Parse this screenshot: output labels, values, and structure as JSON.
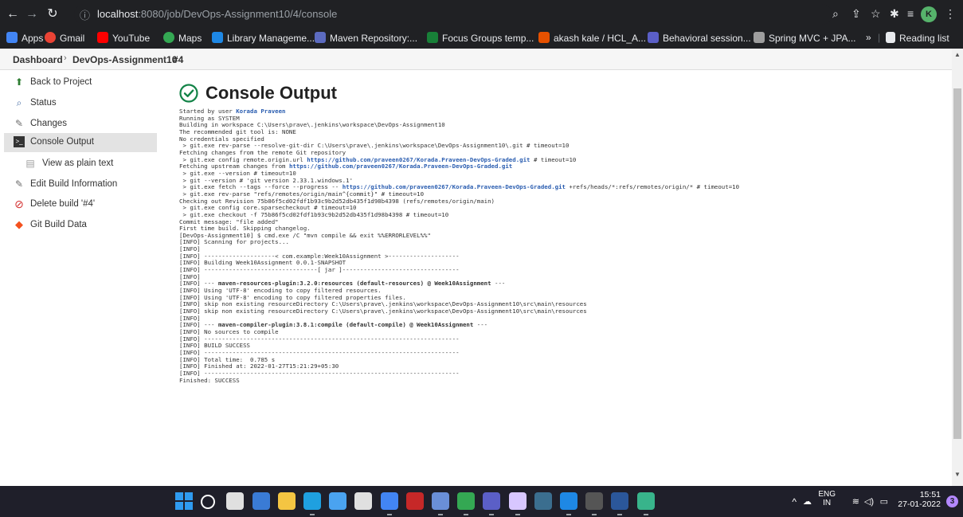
{
  "browser": {
    "url_host": "localhost",
    "url_rest": ":8080/job/DevOps-Assignment10/4/console",
    "profile_initial": "K"
  },
  "bookmarks": [
    {
      "label": "Apps",
      "color": "#4285f4"
    },
    {
      "label": "Gmail",
      "color": "#ea4335"
    },
    {
      "label": "YouTube",
      "color": "#ff0000"
    },
    {
      "label": "Maps",
      "color": "#34a853"
    },
    {
      "label": "Library Manageme...",
      "color": "#1e88e5"
    },
    {
      "label": "Maven Repository:...",
      "color": "#5c6bc0"
    },
    {
      "label": "Focus Groups temp...",
      "color": "#188038"
    },
    {
      "label": "akash kale / HCL_A...",
      "color": "#e65100"
    },
    {
      "label": "Behavioral session...",
      "color": "#5b5fc7"
    },
    {
      "label": "Spring MVC + JPA...",
      "color": "#9e9e9e"
    }
  ],
  "reading_list": "Reading list",
  "breadcrumb": [
    "Dashboard",
    "DevOps-Assignment10",
    "#4"
  ],
  "sidebar": [
    {
      "label": "Back to Project",
      "icon": "up-arrow-icon",
      "glyph": "⬆",
      "color": "#2e7d32"
    },
    {
      "label": "Status",
      "icon": "magnifier-icon",
      "glyph": "🔍",
      "color": "#4a6fa5"
    },
    {
      "label": "Changes",
      "icon": "notepad-icon",
      "glyph": "✎",
      "color": "#6d6d6d"
    },
    {
      "label": "Console Output",
      "icon": "terminal-icon",
      "glyph": "▣",
      "color": "#333333"
    },
    {
      "label": "View as plain text",
      "icon": "document-icon",
      "glyph": "▤",
      "color": "#9e9e9e"
    },
    {
      "label": "Edit Build Information",
      "icon": "notepad-icon",
      "glyph": "✎",
      "color": "#6d6d6d"
    },
    {
      "label": "Delete build '#4'",
      "icon": "no-entry-icon",
      "glyph": "⊘",
      "color": "#d32f2f"
    },
    {
      "label": "Git Build Data",
      "icon": "git-icon",
      "glyph": "◆",
      "color": "#f4511e"
    }
  ],
  "page_title": "Console Output",
  "console_lines": [
    "Started by user |Korada Praveen|",
    "Running as SYSTEM",
    "Building in workspace C:\\Users\\prave\\.jenkins\\workspace\\DevOps-Assignment10",
    "The recommended git tool is: NONE",
    "No credentials specified",
    " > git.exe rev-parse --resolve-git-dir C:\\Users\\prave\\.jenkins\\workspace\\DevOps-Assignment10\\.git # timeout=10",
    "Fetching changes from the remote Git repository",
    " > git.exe config remote.origin.url |https://github.com/praveen0267/Korada.Praveen-DevOps-Graded.git| # timeout=10",
    "Fetching upstream changes from |https://github.com/praveen0267/Korada.Praveen-DevOps-Graded.git|",
    " > git.exe --version # timeout=10",
    " > git --version # 'git version 2.33.1.windows.1'",
    " > git.exe fetch --tags --force --progress -- |https://github.com/praveen0267/Korada.Praveen-DevOps-Graded.git| +refs/heads/*:refs/remotes/origin/* # timeout=10",
    " > git.exe rev-parse \"refs/remotes/origin/main^{commit}\" # timeout=10",
    "Checking out Revision 75b86f5cd02fdf1b93c9b2d52db435f1d98b4398 (refs/remotes/origin/main)",
    " > git.exe config core.sparsecheckout # timeout=10",
    " > git.exe checkout -f 75b86f5cd02fdf1b93c9b2d52db435f1d98b4398 # timeout=10",
    "Commit message: \"file added\"",
    "First time build. Skipping changelog.",
    "[DevOps-Assignment10] $ cmd.exe /C \"mvn compile && exit %%ERRORLEVEL%%\"",
    "[INFO] Scanning for projects...",
    "[INFO]",
    "[INFO] --------------------< com.example:Week10Assignment >--------------------",
    "[INFO] Building Week10Assignment 0.0.1-SNAPSHOT",
    "[INFO] --------------------------------[ jar ]---------------------------------",
    "[INFO]",
    "[INFO] --- ^maven-resources-plugin:3.2.0:resources (default-resources) @ Week10Assignment^ ---",
    "[INFO] Using 'UTF-8' encoding to copy filtered resources.",
    "[INFO] Using 'UTF-8' encoding to copy filtered properties files.",
    "[INFO] skip non existing resourceDirectory C:\\Users\\prave\\.jenkins\\workspace\\DevOps-Assignment10\\src\\main\\resources",
    "[INFO] skip non existing resourceDirectory C:\\Users\\prave\\.jenkins\\workspace\\DevOps-Assignment10\\src\\main\\resources",
    "[INFO]",
    "[INFO] --- ^maven-compiler-plugin:3.8.1:compile (default-compile) @ Week10Assignment^ ---",
    "[INFO] No sources to compile",
    "[INFO] ------------------------------------------------------------------------",
    "[INFO] BUILD SUCCESS",
    "[INFO] ------------------------------------------------------------------------",
    "[INFO] Total time:  0.785 s",
    "[INFO] Finished at: 2022-01-27T15:21:29+05:30",
    "[INFO] ------------------------------------------------------------------------",
    "Finished: SUCCESS"
  ],
  "taskbar": {
    "apps": [
      {
        "name": "windows-start-icon",
        "color": "#2f9bf0"
      },
      {
        "name": "search-icon",
        "color": "#ffffff"
      },
      {
        "name": "task-view-icon",
        "color": "#e0e0e0"
      },
      {
        "name": "widgets-icon",
        "color": "#3a7bd5"
      },
      {
        "name": "file-explorer-icon",
        "color": "#f4c542"
      },
      {
        "name": "edge-icon",
        "color": "#1fa0e0"
      },
      {
        "name": "store-icon",
        "color": "#4aa3f0"
      },
      {
        "name": "github-desktop-icon",
        "color": "#e0e0e0"
      },
      {
        "name": "chrome-icon",
        "color": "#4285f4"
      },
      {
        "name": "mcafee-icon",
        "color": "#c62828"
      },
      {
        "name": "notepad-app-icon",
        "color": "#6a8fd8"
      },
      {
        "name": "chrome-profile-icon",
        "color": "#34a853"
      },
      {
        "name": "teams-icon",
        "color": "#5b5fc7"
      },
      {
        "name": "eclipse-icon",
        "color": "#d8c7ff"
      },
      {
        "name": "mysql-icon",
        "color": "#3b6e8f"
      },
      {
        "name": "vscode-icon",
        "color": "#1e88e5"
      },
      {
        "name": "terminal-app-icon",
        "color": "#555555"
      },
      {
        "name": "word-icon",
        "color": "#2b579a"
      },
      {
        "name": "git-app-icon",
        "color": "#38b48b"
      }
    ],
    "lang": "ENG",
    "region": "IN",
    "time": "15:51",
    "date": "27-01-2022",
    "notifications": "3"
  }
}
